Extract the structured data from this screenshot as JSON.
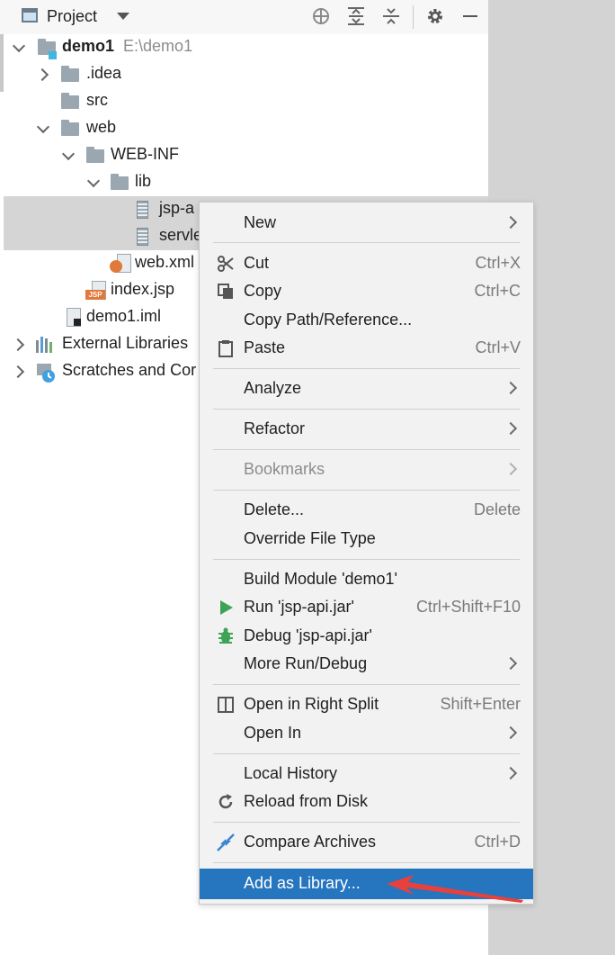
{
  "header": {
    "title": "Project"
  },
  "tree": {
    "project": {
      "name": "demo1",
      "path": "E:\\demo1"
    },
    "idea": ".idea",
    "src": "src",
    "web": "web",
    "webinf": "WEB-INF",
    "lib": "lib",
    "jar1": "jsp-a",
    "jar2": "servle",
    "webxml": "web.xml",
    "indexjsp": "index.jsp",
    "iml": "demo1.iml",
    "extlibs": "External Libraries",
    "scratches": "Scratches and Cor"
  },
  "menu": {
    "new": "New",
    "cut": {
      "label": "Cut",
      "shortcut": "Ctrl+X"
    },
    "copy": {
      "label": "Copy",
      "shortcut": "Ctrl+C"
    },
    "copy_path": "Copy Path/Reference...",
    "paste": {
      "label": "Paste",
      "shortcut": "Ctrl+V"
    },
    "analyze": "Analyze",
    "refactor": "Refactor",
    "bookmarks": "Bookmarks",
    "delete": {
      "label": "Delete...",
      "shortcut": "Delete"
    },
    "override": "Override File Type",
    "build": "Build Module 'demo1'",
    "run": {
      "label": "Run 'jsp-api.jar'",
      "shortcut": "Ctrl+Shift+F10"
    },
    "debug": "Debug 'jsp-api.jar'",
    "more_run": "More Run/Debug",
    "open_split": {
      "label": "Open in Right Split",
      "shortcut": "Shift+Enter"
    },
    "open_in": "Open In",
    "local_history": "Local History",
    "reload": "Reload from Disk",
    "compare": {
      "label": "Compare Archives",
      "shortcut": "Ctrl+D"
    },
    "add_library": "Add as Library..."
  },
  "colors": {
    "highlight": "#2675bf",
    "annotation_arrow": "#e8403a",
    "run_green": "#3fa356"
  }
}
